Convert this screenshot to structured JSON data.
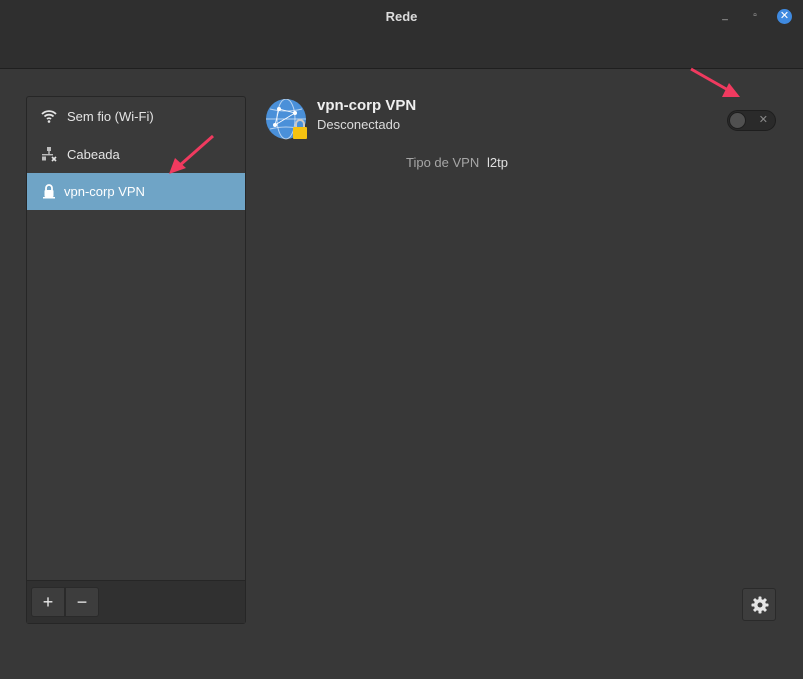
{
  "window": {
    "title": "Rede"
  },
  "sidebar": {
    "items": [
      {
        "label": "Sem fio (Wi-Fi)",
        "icon": "wifi-icon"
      },
      {
        "label": "Cabeada",
        "icon": "wired-network-icon"
      },
      {
        "label": "vpn-corp VPN",
        "icon": "vpn-lock-icon",
        "selected": true
      }
    ],
    "add_label": "+",
    "remove_label": "−"
  },
  "connection": {
    "name": "vpn-corp VPN",
    "status": "Desconectado",
    "vpn_type_label": "Tipo de VPN",
    "vpn_type_value": "l2tp",
    "enabled": false
  },
  "colors": {
    "accent": "#6fa4c6",
    "close_button": "#3f8ae0",
    "annotation_arrow": "#f03a5f"
  }
}
